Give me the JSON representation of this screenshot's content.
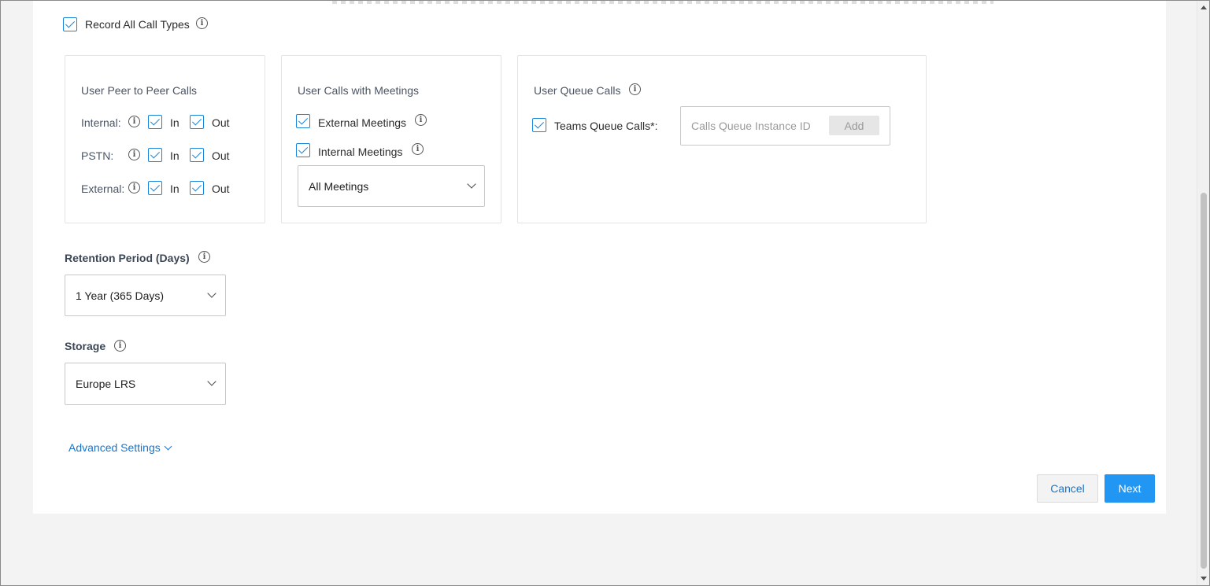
{
  "record_all": {
    "label": "Record All Call Types",
    "checked": true
  },
  "peer_to_peer": {
    "title": "User Peer to Peer Calls",
    "rows": [
      {
        "label": "Internal:",
        "in_label": "In",
        "out_label": "Out"
      },
      {
        "label": "PSTN:",
        "in_label": "In",
        "out_label": "Out"
      },
      {
        "label": "External:",
        "in_label": "In",
        "out_label": "Out"
      }
    ]
  },
  "meetings": {
    "title": "User Calls with Meetings",
    "external_label": "External Meetings",
    "internal_label": "Internal Meetings",
    "select_value": "All Meetings"
  },
  "queue": {
    "title": "User Queue Calls",
    "teams_label": "Teams Queue Calls*:",
    "input_placeholder": "Calls Queue Instance ID",
    "add_label": "Add"
  },
  "retention": {
    "title": "Retention Period (Days)",
    "value": "1 Year (365 Days)"
  },
  "storage": {
    "title": "Storage",
    "value": "Europe LRS"
  },
  "advanced": {
    "label": "Advanced Settings"
  },
  "footer": {
    "cancel_label": "Cancel",
    "next_label": "Next"
  },
  "colors": {
    "accent": "#1a86d9",
    "primary_button": "#2196f3",
    "link": "#1a73c8"
  }
}
